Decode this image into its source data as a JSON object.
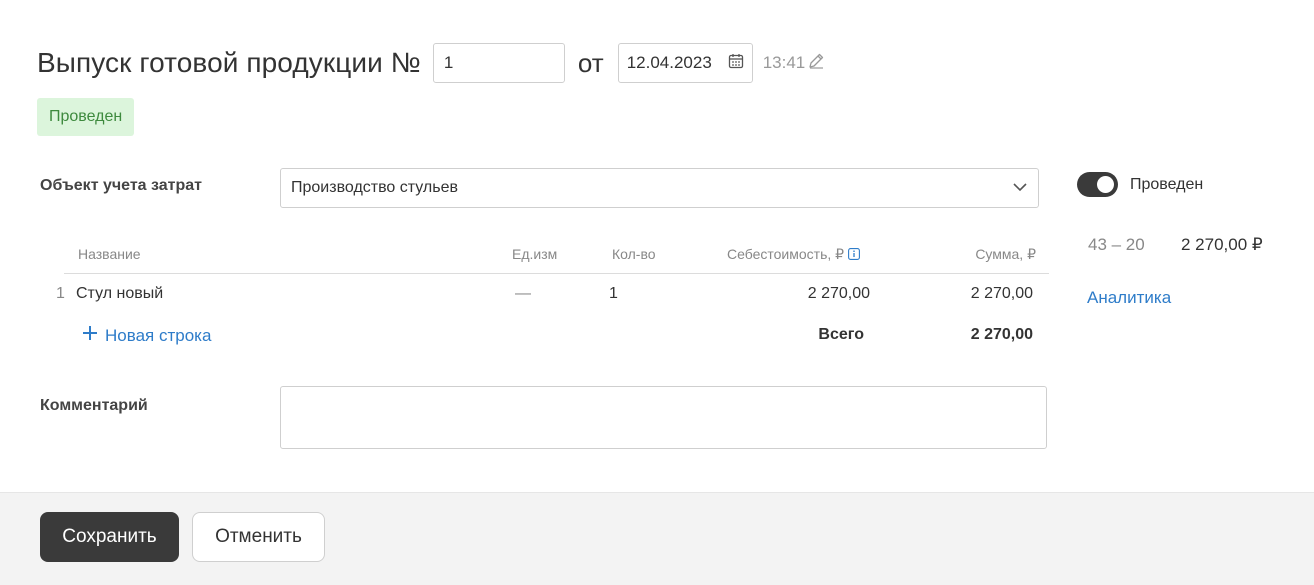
{
  "header": {
    "title": "Выпуск готовой продукции №",
    "number_value": "1",
    "from_label": "от",
    "date": "12.04.2023",
    "time": "13:41"
  },
  "status_badge": "Проведен",
  "cost_object": {
    "label": "Объект учета затрат",
    "value": "Производство стульев"
  },
  "table": {
    "headers": {
      "name": "Название",
      "unit": "Ед.изм",
      "qty": "Кол-во",
      "cost": "Себестоимость, ₽",
      "sum": "Сумма, ₽"
    },
    "rows": [
      {
        "index": "1",
        "name": "Стул новый",
        "unit": "—",
        "qty": "1",
        "cost": "2 270,00",
        "sum": "2 270,00"
      }
    ],
    "add_row": "Новая строка",
    "total_label": "Всего",
    "total_value": "2 270,00"
  },
  "comment": {
    "label": "Комментарий",
    "value": ""
  },
  "side": {
    "posted_label": "Проведен",
    "posted": true,
    "account": "43 – 20",
    "account_sum": "2 270,00 ₽",
    "analytics_link": "Аналитика"
  },
  "footer": {
    "save": "Сохранить",
    "cancel": "Отменить"
  },
  "colors": {
    "accent_link": "#2e7cc9",
    "badge_bg": "#dcf5dc",
    "badge_text": "#3e8a3e",
    "primary_button": "#3a3a3a"
  }
}
